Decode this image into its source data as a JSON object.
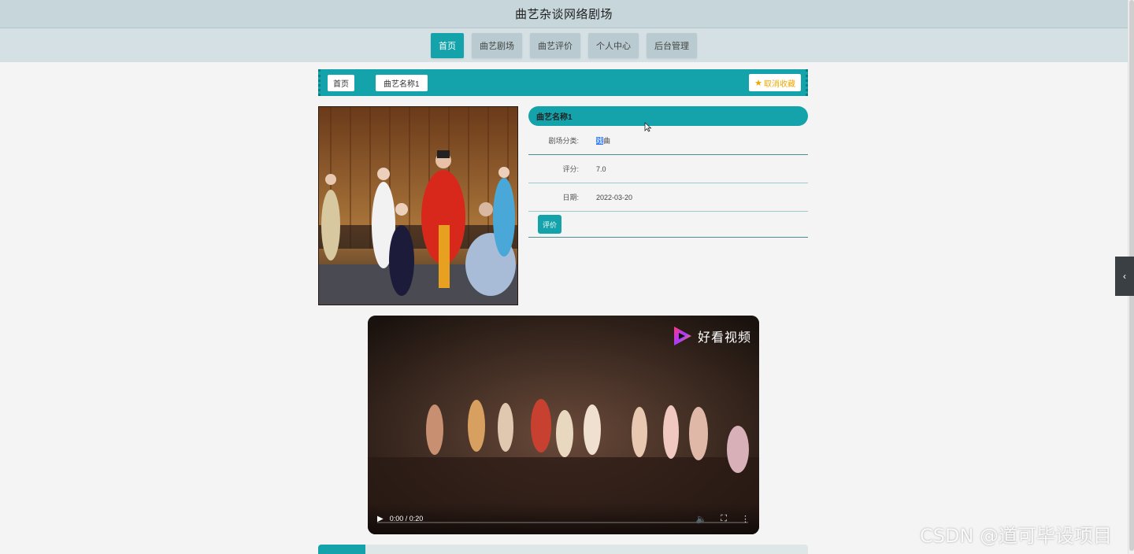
{
  "site": {
    "title": "曲艺杂谈网络剧场"
  },
  "nav": {
    "items": [
      {
        "label": "首页",
        "active": true
      },
      {
        "label": "曲艺剧场",
        "active": false
      },
      {
        "label": "曲艺评价",
        "active": false
      },
      {
        "label": "个人中心",
        "active": false
      },
      {
        "label": "后台管理",
        "active": false
      }
    ]
  },
  "breadcrumb": {
    "home": "首页",
    "current": "曲艺名称1",
    "favorite_label": "取消收藏"
  },
  "detail": {
    "name": "曲艺名称1",
    "fields": [
      {
        "label": "剧场分类:",
        "value_sel": "戏",
        "value_rest": "曲"
      },
      {
        "label": "评分:",
        "value": "7.0"
      },
      {
        "label": "日期:",
        "value": "2022-03-20"
      }
    ],
    "review_button": "评价"
  },
  "video": {
    "brand": "好看视频",
    "time": "0:00 / 0:20",
    "progress": 0,
    "subtitle": "",
    "play_icon": "play-icon",
    "mute_icon": "volume-icon",
    "fullscreen_icon": "fullscreen-icon",
    "more_icon": "more-vert-icon"
  },
  "watermark": "CSDN @道可毕设项目",
  "colors": {
    "accent": "#14a3ab",
    "topbar": "#c6d6da",
    "navbar": "#d5e0e4",
    "star": "#f0a800"
  }
}
